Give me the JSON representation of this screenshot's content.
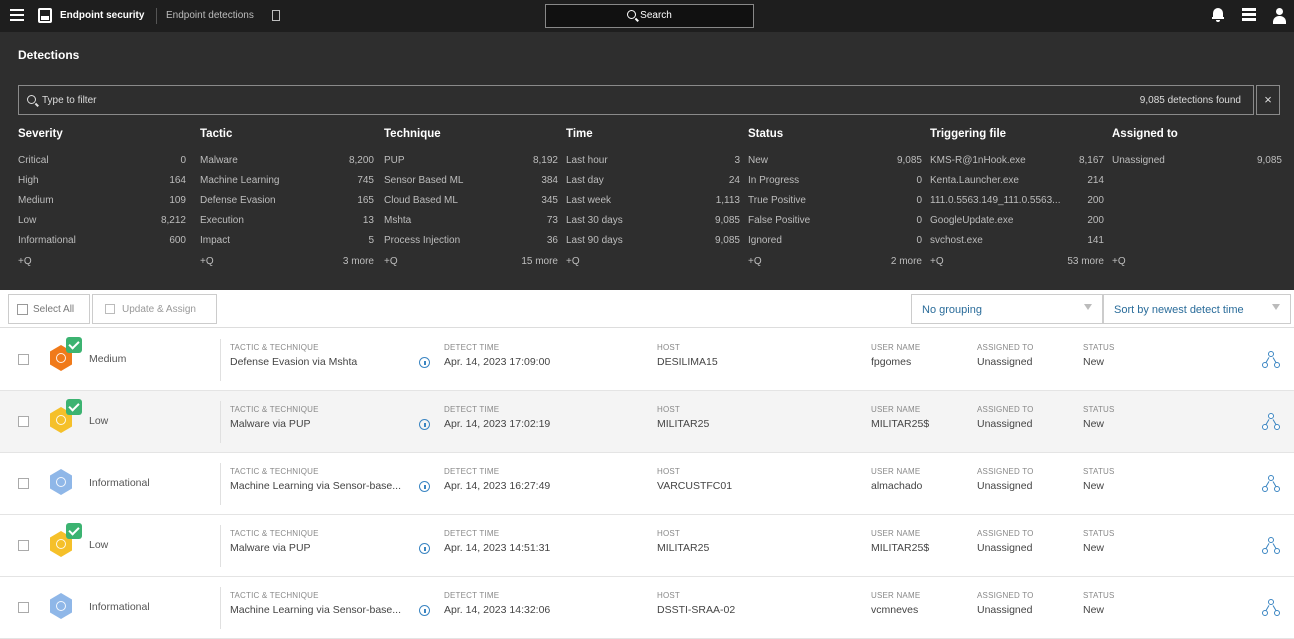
{
  "header": {
    "app_title": "Endpoint security",
    "tab_title": "Endpoint detections",
    "search_label": "Search"
  },
  "page": {
    "title": "Detections",
    "filter_placeholder": "Type to filter",
    "found": "9,085 detections found",
    "clear": "×"
  },
  "facets": [
    {
      "title": "Severity",
      "items": [
        {
          "label": "Critical",
          "count": "0"
        },
        {
          "label": "High",
          "count": "164"
        },
        {
          "label": "Medium",
          "count": "109"
        },
        {
          "label": "Low",
          "count": "8,212"
        },
        {
          "label": "Informational",
          "count": "600"
        }
      ],
      "add": "+Q",
      "more": ""
    },
    {
      "title": "Tactic",
      "items": [
        {
          "label": "Malware",
          "count": "8,200"
        },
        {
          "label": "Machine Learning",
          "count": "745"
        },
        {
          "label": "Defense Evasion",
          "count": "165"
        },
        {
          "label": "Execution",
          "count": "13"
        },
        {
          "label": "Impact",
          "count": "5"
        }
      ],
      "add": "+Q",
      "more": "3 more"
    },
    {
      "title": "Technique",
      "items": [
        {
          "label": "PUP",
          "count": "8,192"
        },
        {
          "label": "Sensor Based ML",
          "count": "384"
        },
        {
          "label": "Cloud Based ML",
          "count": "345"
        },
        {
          "label": "Mshta",
          "count": "73"
        },
        {
          "label": "Process Injection",
          "count": "36"
        }
      ],
      "add": "+Q",
      "more": "15 more"
    },
    {
      "title": "Time",
      "items": [
        {
          "label": "Last hour",
          "count": "3"
        },
        {
          "label": "Last day",
          "count": "24"
        },
        {
          "label": "Last week",
          "count": "1,113"
        },
        {
          "label": "Last 30 days",
          "count": "9,085"
        },
        {
          "label": "Last 90 days",
          "count": "9,085"
        }
      ],
      "add": "+Q",
      "more": ""
    },
    {
      "title": "Status",
      "items": [
        {
          "label": "New",
          "count": "9,085"
        },
        {
          "label": "In Progress",
          "count": "0"
        },
        {
          "label": "True Positive",
          "count": "0"
        },
        {
          "label": "False Positive",
          "count": "0"
        },
        {
          "label": "Ignored",
          "count": "0"
        }
      ],
      "add": "+Q",
      "more": "2 more"
    },
    {
      "title": "Triggering file",
      "items": [
        {
          "label": "KMS-R@1nHook.exe",
          "count": "8,167"
        },
        {
          "label": "Kenta.Launcher.exe",
          "count": "214"
        },
        {
          "label": "111.0.5563.149_111.0.5563...",
          "count": "200"
        },
        {
          "label": "GoogleUpdate.exe",
          "count": "200"
        },
        {
          "label": "svchost.exe",
          "count": "141"
        }
      ],
      "add": "+Q",
      "more": "53 more"
    },
    {
      "title": "Assigned to",
      "items": [
        {
          "label": "Unassigned",
          "count": "9,085"
        }
      ],
      "add": "+Q",
      "more": ""
    }
  ],
  "toolbar": {
    "select_all": "Select All",
    "update_assign": "Update & Assign",
    "grouping": "No grouping",
    "sort": "Sort by newest detect time"
  },
  "labels": {
    "tactic": "TACTIC & TECHNIQUE",
    "time": "DETECT TIME",
    "host": "HOST",
    "user": "USER NAME",
    "assigned": "ASSIGNED TO",
    "status": "STATUS"
  },
  "severity_colors": {
    "Medium": "#f07a1a",
    "Low": "#f5c02a",
    "Informational": "#8fb7e8"
  },
  "detections": [
    {
      "severity": "Medium",
      "tactic": "Defense Evasion via Mshta",
      "time": "Apr. 14, 2023 17:09:00",
      "host": "DESILIMA15",
      "user": "fpgomes",
      "assigned": "Unassigned",
      "status": "New",
      "checked": true
    },
    {
      "severity": "Low",
      "tactic": "Malware via PUP",
      "time": "Apr. 14, 2023 17:02:19",
      "host": "MILITAR25",
      "user": "MILITAR25$",
      "assigned": "Unassigned",
      "status": "New",
      "checked": true
    },
    {
      "severity": "Informational",
      "tactic": "Machine Learning via Sensor-base...",
      "time": "Apr. 14, 2023 16:27:49",
      "host": "VARCUSTFC01",
      "user": "almachado",
      "assigned": "Unassigned",
      "status": "New",
      "checked": false
    },
    {
      "severity": "Low",
      "tactic": "Malware via PUP",
      "time": "Apr. 14, 2023 14:51:31",
      "host": "MILITAR25",
      "user": "MILITAR25$",
      "assigned": "Unassigned",
      "status": "New",
      "checked": true
    },
    {
      "severity": "Informational",
      "tactic": "Machine Learning via Sensor-base...",
      "time": "Apr. 14, 2023 14:32:06",
      "host": "DSSTI-SRAA-02",
      "user": "vcmneves",
      "assigned": "Unassigned",
      "status": "New",
      "checked": false
    }
  ]
}
